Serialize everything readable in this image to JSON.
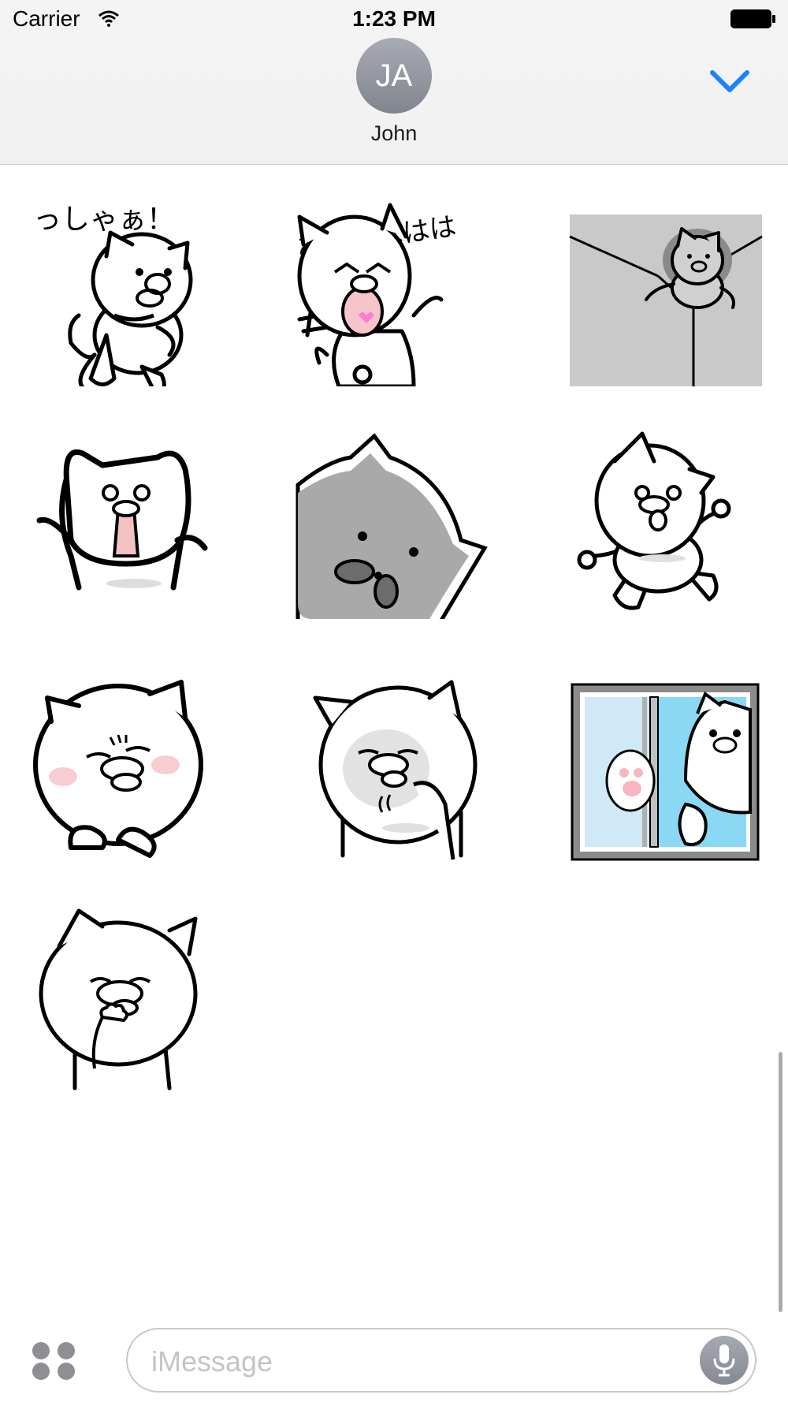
{
  "status_bar": {
    "carrier": "Carrier",
    "time": "1:23 PM"
  },
  "header": {
    "avatar_initials": "JA",
    "contact_name": "John",
    "accent_color": "#1a82fb"
  },
  "stickers": [
    {
      "name": "cat-shouting-sticker",
      "caption": "っしゃぁ！"
    },
    {
      "name": "cat-laughing-sticker",
      "caption": "あははははは"
    },
    {
      "name": "cat-wall-climb-sticker",
      "caption": ""
    },
    {
      "name": "cat-arms-up-sticker",
      "caption": ""
    },
    {
      "name": "cat-closeup-sticker",
      "caption": ""
    },
    {
      "name": "cat-running-sticker",
      "caption": ""
    },
    {
      "name": "cat-blushing-sticker",
      "caption": ""
    },
    {
      "name": "cat-thinking-sticker",
      "caption": ""
    },
    {
      "name": "cat-window-sticker",
      "caption": ""
    },
    {
      "name": "cat-smirk-sticker",
      "caption": ""
    }
  ],
  "composer": {
    "placeholder": "iMessage",
    "apps_icon": "app-drawer-icon",
    "mic_icon": "microphone-icon"
  }
}
